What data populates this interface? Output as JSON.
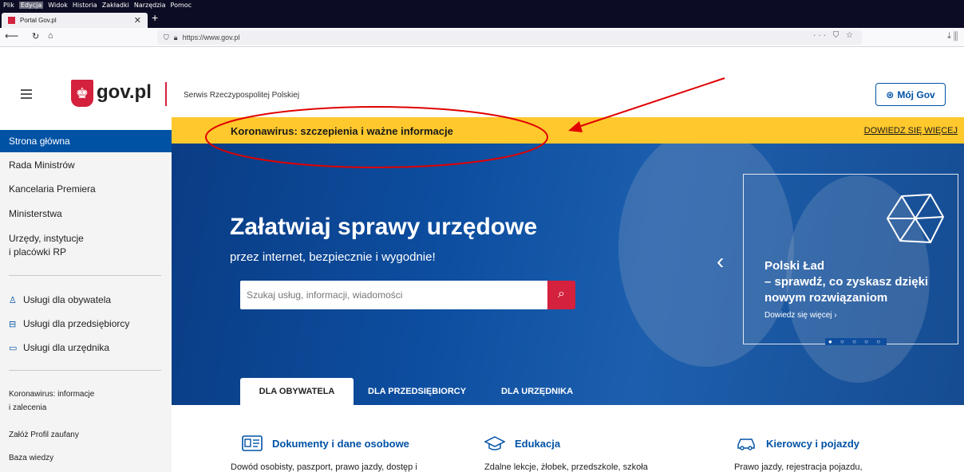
{
  "browser": {
    "menu": [
      "Plik",
      "Edycja",
      "Widok",
      "Historia",
      "Zakładki",
      "Narzędzia",
      "Pomoc"
    ],
    "tab_title": "Portal Gov.pl",
    "url": "https://www.gov.pl",
    "url_actions": "··· ⛉ ☆",
    "right_tools": "⤓ ⫼"
  },
  "header": {
    "logo_text": "gov.pl",
    "tagline": "Serwis Rzeczypospolitej Polskiej",
    "account_button": "Mój Gov"
  },
  "sidebar": {
    "items": [
      {
        "label": "Strona główna",
        "active": true
      },
      {
        "label": "Rada Ministrów"
      },
      {
        "label": "Kancelaria Premiera"
      },
      {
        "label": "Ministerstwa"
      },
      {
        "label": "Urzędy, instytucje"
      },
      {
        "label": "i placówki RP"
      }
    ],
    "services": [
      {
        "label": "Usługi dla obywatela",
        "icon": "person-icon"
      },
      {
        "label": "Usługi dla przedsiębiorcy",
        "icon": "briefcase-icon"
      },
      {
        "label": "Usługi dla urzędnika",
        "icon": "laptop-icon"
      }
    ],
    "links": [
      "Koronawirus: informacje",
      "i zalecenia",
      "Załóż Profil zaufany",
      "Baza wiedzy"
    ]
  },
  "banner": {
    "text": "Koronawirus: szczepienia i ważne informacje",
    "link": "DOWIEDZ SIĘ WIĘCEJ",
    "color": "#ffc82c"
  },
  "hero": {
    "title": "Załatwiaj sprawy urzędowe",
    "subtitle": "przez internet, bezpiecznie i wygodnie!",
    "search_placeholder": "Szukaj usług, informacji, wiadomości",
    "card": {
      "title_lines": [
        "Polski Ład",
        "– sprawdź, co zyskasz dzięki",
        "nowym rozwiązaniom"
      ],
      "link": "Dowiedz się więcej ›",
      "dots": "● ○ ○ ○ ○",
      "prev": "‹"
    }
  },
  "tabs": {
    "items": [
      "DLA OBYWATELA",
      "DLA PRZEDSIĘBIORCY",
      "DLA URZĘDNIKA"
    ]
  },
  "categories": [
    {
      "title": "Dokumenty i dane osobowe",
      "desc": "Dowód osobisty, paszport, prawo jazdy, dostęp i",
      "icon": "id-card-icon"
    },
    {
      "title": "Edukacja",
      "desc": "Zdalne lekcje, żłobek, przedszkole, szkoła",
      "icon": "graduation-cap-icon"
    },
    {
      "title": "Kierowcy i pojazdy",
      "desc": "Prawo jazdy, rejestracja pojazdu,",
      "icon": "car-icon"
    }
  ],
  "colors": {
    "primary": "#0052a5",
    "accent_red": "#d4213d",
    "annotation": "#e00000"
  }
}
